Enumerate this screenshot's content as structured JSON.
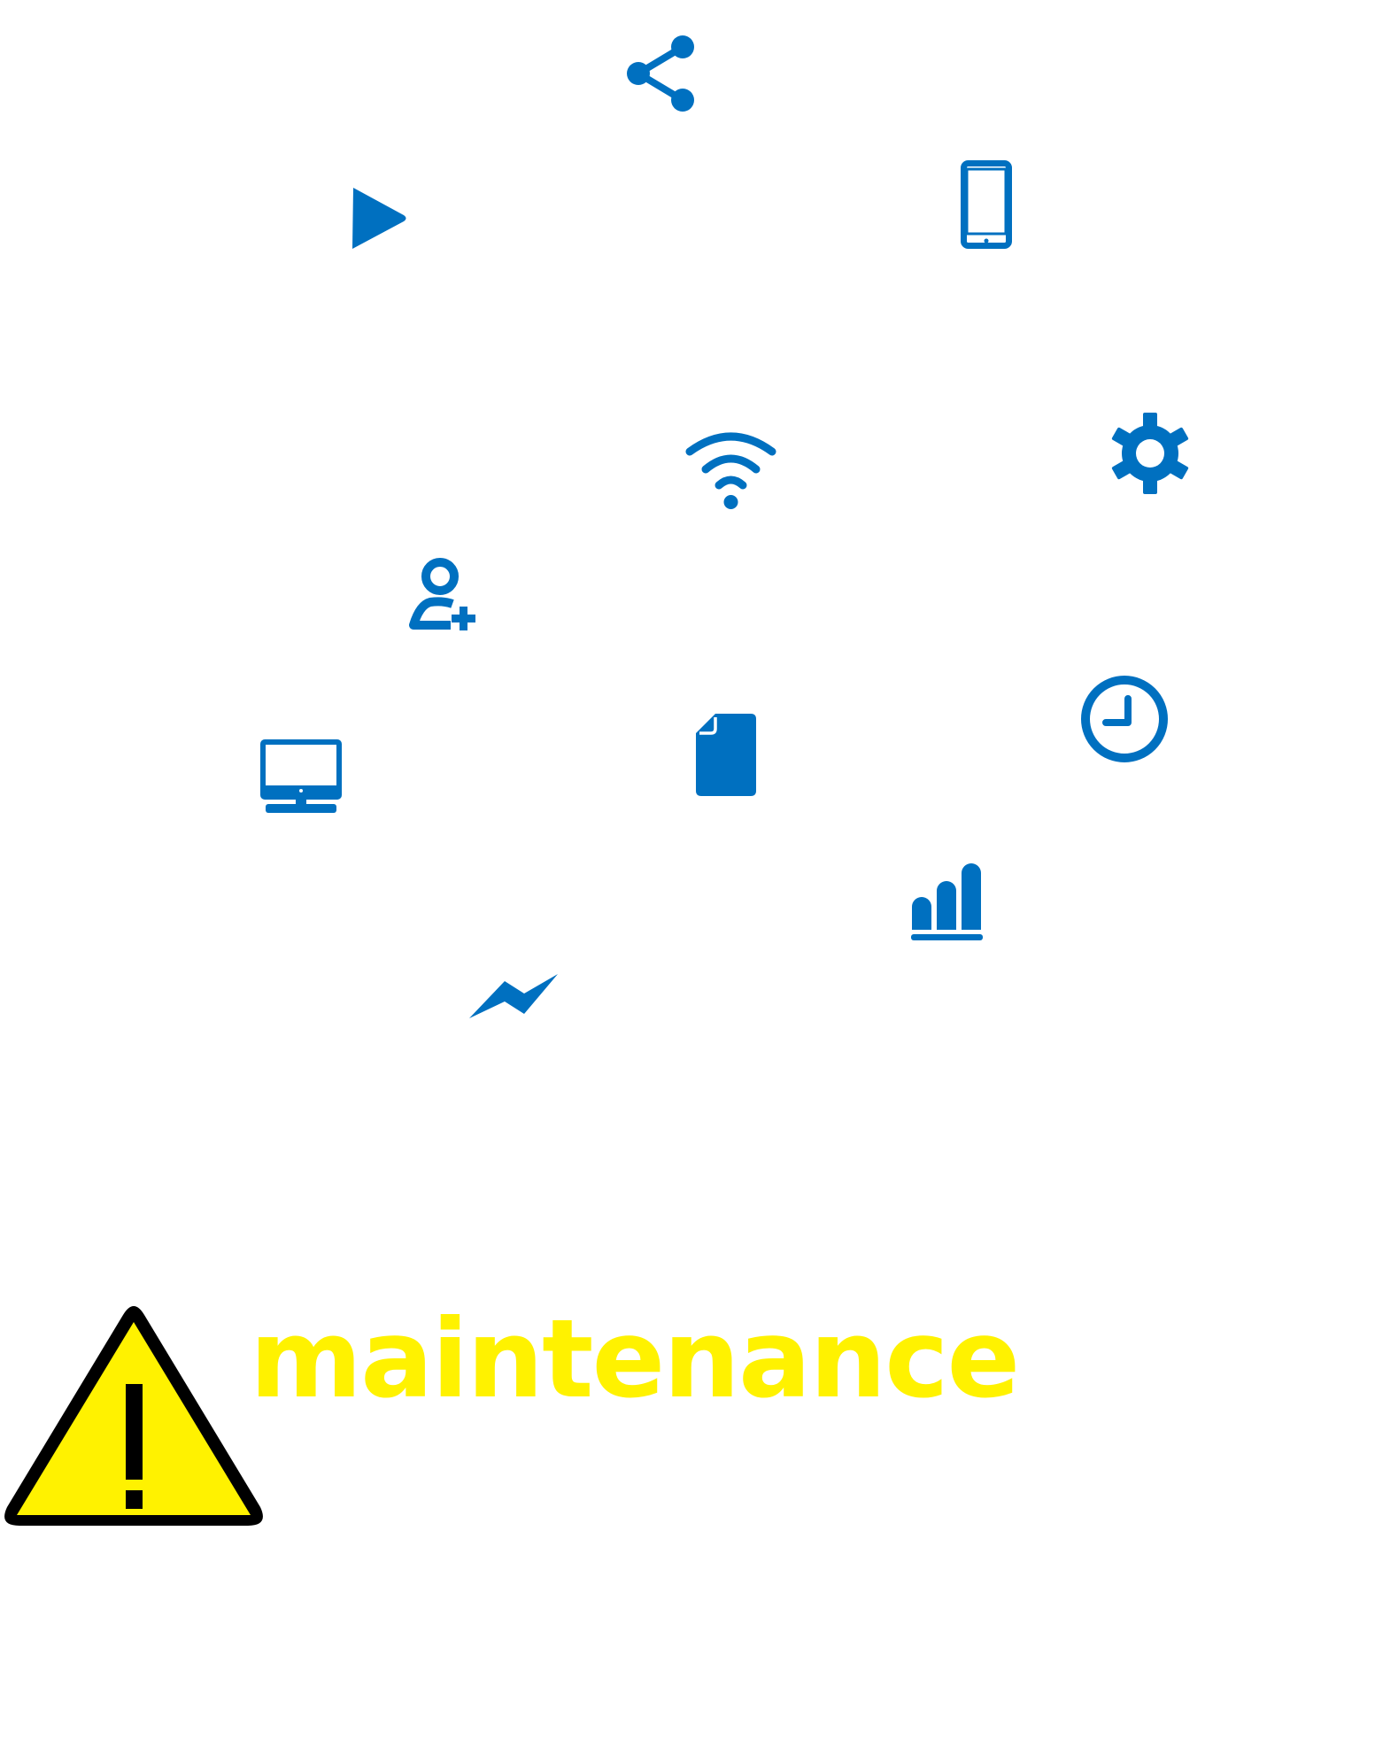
{
  "colors": {
    "icon_blue": "#0070c0",
    "warning_yellow": "#fff200",
    "warning_stroke": "#000000",
    "label_yellow": "#fff200",
    "background": "#ffffff"
  },
  "icons": [
    "share-icon",
    "play-icon",
    "smartphone-icon",
    "wifi-icon",
    "gear-icon",
    "add-user-icon",
    "clock-icon",
    "monitor-icon",
    "document-icon",
    "bar-chart-icon",
    "trend-line-icon",
    "warning-icon"
  ],
  "banner": {
    "label": "maintenance"
  }
}
